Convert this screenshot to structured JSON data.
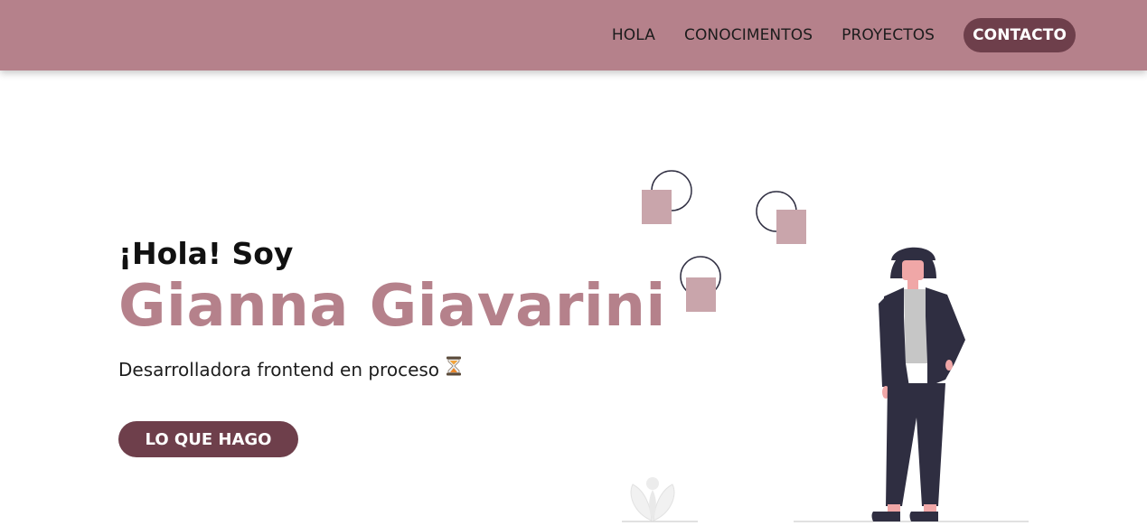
{
  "nav": {
    "items": [
      {
        "label": "HOLA"
      },
      {
        "label": "CONOCIMENTOS"
      },
      {
        "label": "PROYECTOS"
      },
      {
        "label": "CONTACTO",
        "active": true
      }
    ]
  },
  "hero": {
    "greeting": "¡Hola! Soy",
    "name": "Gianna Giavarini",
    "subtitle": "Desarrolladora frontend en proceso",
    "subtitle_icon": "hourglass-icon",
    "cta_label": "LO QUE HAGO"
  },
  "colors": {
    "navbar": "#b5818b",
    "accent": "#6e3f4b",
    "name": "#b5818b",
    "squares": "#c9a5ab",
    "figure": "#2f2e41"
  },
  "illustration": {
    "subject": "woman-standing-illustration",
    "decor": [
      "circle-square-shape",
      "circle-square-shape",
      "circle-square-shape",
      "plant-icon"
    ]
  }
}
